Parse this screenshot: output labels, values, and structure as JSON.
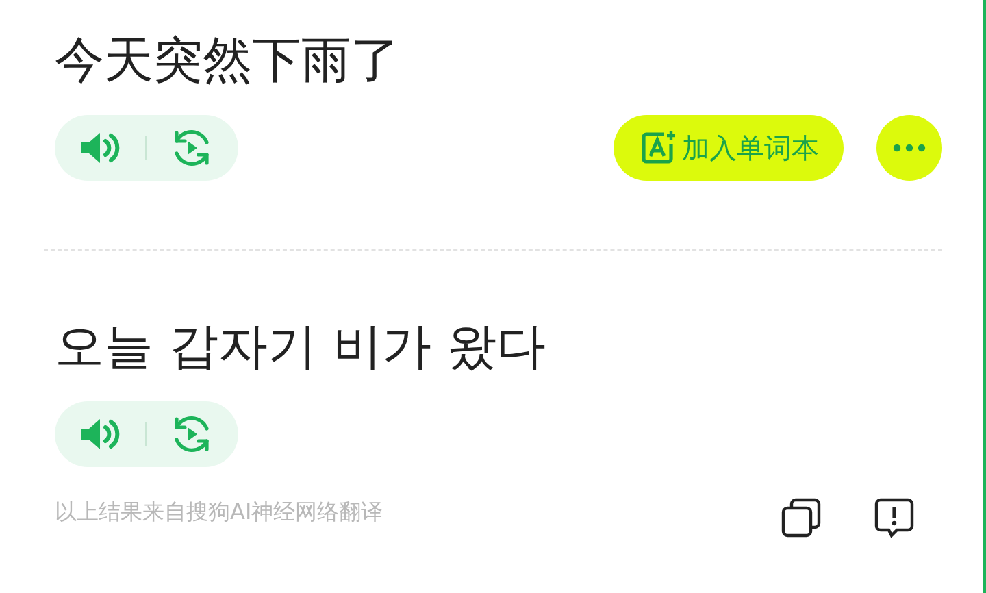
{
  "source": {
    "text": "今天突然下雨了"
  },
  "add_button": {
    "label": "加入单词本"
  },
  "translation": {
    "text": "오늘 갑자기 비가 왔다"
  },
  "attribution": "以上结果来自搜狗AI神经网络翻译"
}
